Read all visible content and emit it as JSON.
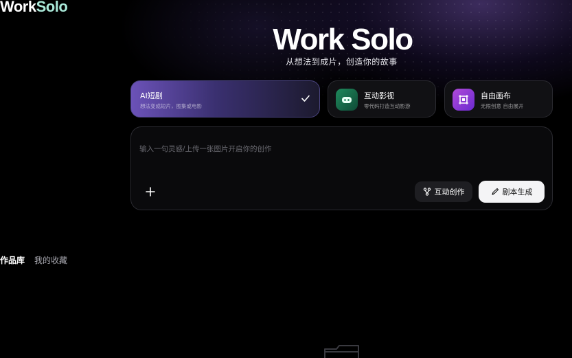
{
  "app": {
    "logo_word1": "Work",
    "logo_word2": "Solo"
  },
  "hero": {
    "title": "Work Solo",
    "subtitle": "从想法到成片，创造你的故事"
  },
  "modes": [
    {
      "title": "AI短剧",
      "desc": "想法变成短片，图集或电影",
      "selected": true,
      "icon": "check-icon"
    },
    {
      "title": "互动影视",
      "desc": "零代码打造互动影游",
      "selected": false,
      "icon": "gamepad-icon"
    },
    {
      "title": "自由画布",
      "desc": "无限创意 自由展开",
      "selected": false,
      "icon": "canvas-icon"
    }
  ],
  "prompt": {
    "placeholder": "输入一句灵感/上传一张图片开启你的创作",
    "value": ""
  },
  "actions": {
    "add_icon": "plus-icon",
    "interactive_label": "互动创作",
    "interactive_icon": "branch-icon",
    "script_label": "剧本生成",
    "script_icon": "pen-icon"
  },
  "library_tabs": [
    {
      "label": "作品库",
      "active": true
    },
    {
      "label": "我的收藏",
      "active": false
    }
  ],
  "empty_state": {
    "icon": "folder-icon"
  },
  "colors": {
    "background": "#000000",
    "accent_purple": "#6b52b8",
    "logo_accent": "#a9e8d8",
    "primary_button": "#f4f4f6"
  }
}
